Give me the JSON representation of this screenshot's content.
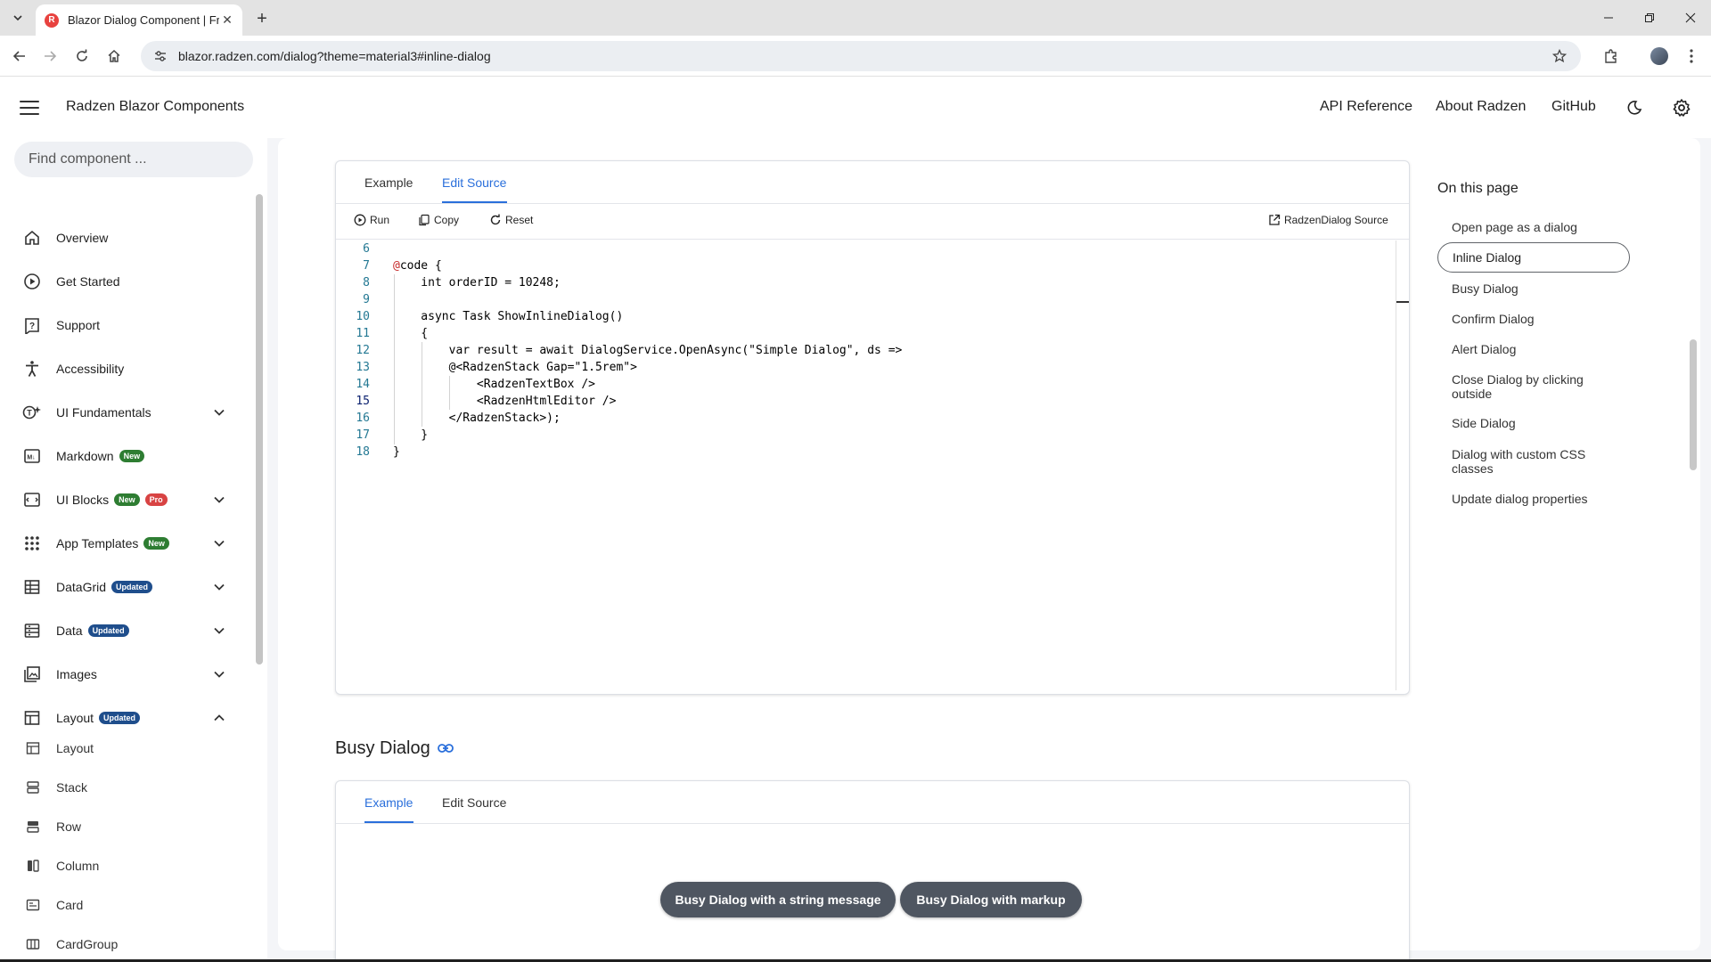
{
  "browser": {
    "tab_title": "Blazor Dialog Component | Free",
    "url": "blazor.radzen.com/dialog?theme=material3#inline-dialog"
  },
  "header": {
    "app_title": "Radzen Blazor Components",
    "links": [
      "API Reference",
      "About Radzen",
      "GitHub"
    ]
  },
  "sidebar": {
    "search_placeholder": "Find component ...",
    "items": [
      {
        "label": "Overview",
        "icon": "home-icon"
      },
      {
        "label": "Get Started",
        "icon": "play-circle-icon"
      },
      {
        "label": "Support",
        "icon": "help-icon"
      },
      {
        "label": "Accessibility",
        "icon": "accessibility-icon"
      },
      {
        "label": "UI Fundamentals",
        "icon": "ui-fundamentals-icon"
      },
      {
        "label": "Markdown",
        "icon": "markdown-icon",
        "badges": [
          "New"
        ]
      },
      {
        "label": "UI Blocks",
        "icon": "ui-blocks-icon",
        "badges": [
          "New",
          "Pro"
        ]
      },
      {
        "label": "App Templates",
        "icon": "apps-icon",
        "badges": [
          "New"
        ]
      },
      {
        "label": "DataGrid",
        "icon": "grid-icon",
        "badges": [
          "Updated"
        ]
      },
      {
        "label": "Data",
        "icon": "data-list-icon",
        "badges": [
          "Updated"
        ]
      },
      {
        "label": "Images",
        "icon": "images-icon"
      },
      {
        "label": "Layout",
        "icon": "layout-icon",
        "badges": [
          "Updated"
        ]
      }
    ],
    "sub_items": [
      "Layout",
      "Stack",
      "Row",
      "Column",
      "Card",
      "CardGroup"
    ]
  },
  "source_panel": {
    "tabs": [
      "Example",
      "Edit Source"
    ],
    "active_tab": "Edit Source",
    "toolbar": {
      "run": "Run",
      "copy": "Copy",
      "reset": "Reset",
      "source_link": "RadzenDialog Source"
    },
    "code_lines": [
      {
        "n": "6",
        "text": ""
      },
      {
        "n": "7",
        "text": "@code {"
      },
      {
        "n": "8",
        "text": "    int orderID = 10248;"
      },
      {
        "n": "9",
        "text": ""
      },
      {
        "n": "10",
        "text": "    async Task ShowInlineDialog()"
      },
      {
        "n": "11",
        "text": "    {"
      },
      {
        "n": "12",
        "text": "        var result = await DialogService.OpenAsync(\"Simple Dialog\", ds =>"
      },
      {
        "n": "13",
        "text": "        @<RadzenStack Gap=\"1.5rem\">"
      },
      {
        "n": "14",
        "text": "            <RadzenTextBox />"
      },
      {
        "n": "15",
        "text": "            <RadzenHtmlEditor />"
      },
      {
        "n": "16",
        "text": "        </RadzenStack>);"
      },
      {
        "n": "17",
        "text": "    }"
      },
      {
        "n": "18",
        "text": "}"
      }
    ],
    "current_line": "15"
  },
  "busy_section": {
    "title": "Busy Dialog",
    "tabs": [
      "Example",
      "Edit Source"
    ],
    "active_tab": "Example",
    "buttons": [
      "Busy Dialog with a string message",
      "Busy Dialog with markup"
    ]
  },
  "toc": {
    "title": "On this page",
    "items": [
      "Open page as a dialog",
      "Inline Dialog",
      "Busy Dialog",
      "Confirm Dialog",
      "Alert Dialog",
      "Close Dialog by clicking outside",
      "Side Dialog",
      "Dialog with custom CSS classes",
      "Update dialog properties"
    ],
    "active": "Inline Dialog"
  },
  "colors": {
    "accent": "#2a6fdb",
    "button": "#4f5661",
    "badge_new": "#2e7d32",
    "badge_pro": "#d84343",
    "badge_updated": "#1f4e8c"
  }
}
